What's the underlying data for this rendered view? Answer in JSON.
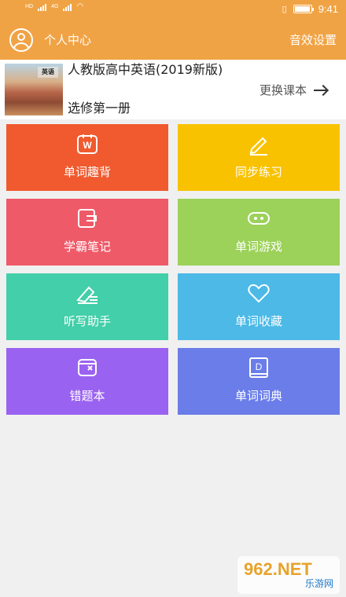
{
  "status_bar": {
    "time": "9:41",
    "network_left": "HD",
    "network_type": "4G"
  },
  "header": {
    "title": "个人中心",
    "settings_label": "音效设置"
  },
  "book": {
    "title": "人教版高中英语(2019新版)",
    "volume": "选修第一册",
    "cover_text": "英语",
    "change_label": "更换课本"
  },
  "tiles": [
    {
      "label": "单词趣背",
      "icon": "word-w-icon",
      "color": "#f05a2e"
    },
    {
      "label": "同步练习",
      "icon": "pencil-icon",
      "color": "#f9c200"
    },
    {
      "label": "学霸笔记",
      "icon": "notebook-icon",
      "color": "#ef5a68"
    },
    {
      "label": "单词游戏",
      "icon": "gamepad-icon",
      "color": "#9cd15a"
    },
    {
      "label": "听写助手",
      "icon": "eraser-pen-icon",
      "color": "#42cfa9"
    },
    {
      "label": "单词收藏",
      "icon": "heart-icon",
      "color": "#4cb9e6"
    },
    {
      "label": "错题本",
      "icon": "wrong-book-icon",
      "color": "#9a62f0"
    },
    {
      "label": "单词词典",
      "icon": "dictionary-d-icon",
      "color": "#6a7de9"
    }
  ],
  "watermark": {
    "brand": "962.NET",
    "site": "乐游网"
  }
}
